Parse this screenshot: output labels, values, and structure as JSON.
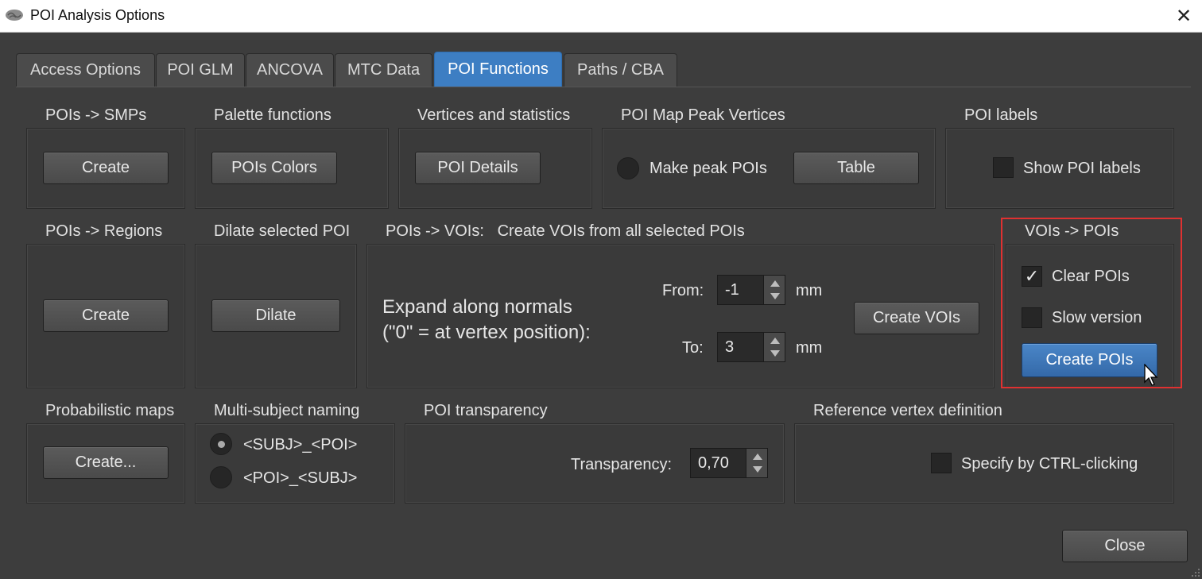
{
  "window": {
    "title": "POI Analysis Options",
    "close_glyph": "✕"
  },
  "tabs": [
    {
      "label": "Access Options"
    },
    {
      "label": "POI GLM"
    },
    {
      "label": "ANCOVA"
    },
    {
      "label": "MTC Data"
    },
    {
      "label": "POI Functions",
      "active": true
    },
    {
      "label": "Paths / CBA"
    }
  ],
  "groups": {
    "pois_smps": {
      "title": "POIs -> SMPs",
      "button": "Create"
    },
    "palette": {
      "title": "Palette functions",
      "button": "POIs Colors"
    },
    "vertices": {
      "title": "Vertices and statistics",
      "button": "POI Details"
    },
    "peak": {
      "title": "POI Map Peak Vertices",
      "radio_label": "Make peak POIs",
      "button": "Table"
    },
    "labels": {
      "title": "POI labels",
      "checkbox_label": "Show POI labels"
    },
    "pois_regions": {
      "title": "POIs -> Regions",
      "button": "Create"
    },
    "dilate": {
      "title": "Dilate selected POI",
      "button": "Dilate"
    },
    "pois_vois": {
      "title": "POIs -> VOIs:   Create VOIs from all selected POIs",
      "expand_line1": "Expand along normals",
      "expand_line2": "(\"0\" = at vertex position):",
      "from_label": "From:",
      "from_value": "-1",
      "from_unit": "mm",
      "to_label": "To:",
      "to_value": "3",
      "to_unit": "mm",
      "button": "Create VOIs"
    },
    "vois_pois": {
      "title": "VOIs -> POIs",
      "clear_label": "Clear POIs",
      "clear_checked": true,
      "check_glyph": "✓",
      "slow_label": "Slow version",
      "slow_checked": false,
      "button": "Create POIs"
    },
    "probabilistic": {
      "title": "Probabilistic maps",
      "button": "Create..."
    },
    "naming": {
      "title": "Multi-subject naming",
      "option1": "<SUBJ>_<POI>",
      "option2": "<POI>_<SUBJ>"
    },
    "transparency": {
      "title": "POI transparency",
      "label": "Transparency:",
      "value": "0,70"
    },
    "reference": {
      "title": "Reference vertex definition",
      "checkbox_label": "Specify by CTRL-clicking"
    }
  },
  "footer": {
    "close_button": "Close"
  },
  "colors": {
    "background": "#3d3d3d",
    "accent": "#3d7ec3",
    "highlight": "#e03131"
  },
  "icons": [
    "brain-app-icon",
    "close-icon",
    "checkmark-icon",
    "spin-up-icon",
    "spin-down-icon",
    "mouse-cursor-icon",
    "resize-grip-icon"
  ]
}
